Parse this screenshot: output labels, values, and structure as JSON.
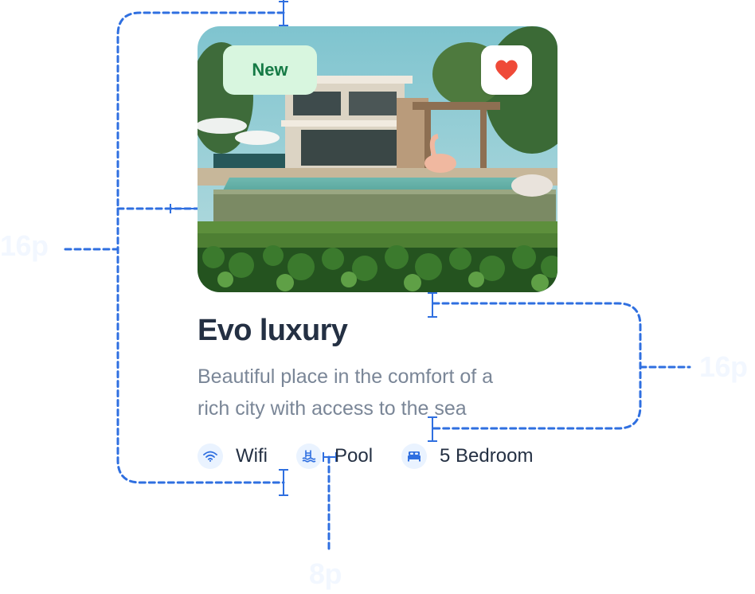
{
  "card": {
    "badge": "New",
    "title": "Evo luxury",
    "description_line1": "Beautiful place in the comfort of a",
    "description_line2": "rich city with access to the sea",
    "features": [
      {
        "label": "Wifi",
        "icon": "wifi-icon"
      },
      {
        "label": "Pool",
        "icon": "pool-icon"
      },
      {
        "label": "5 Bedroom",
        "icon": "bed-icon"
      }
    ]
  },
  "annotations": {
    "left_spacing": "16p",
    "right_spacing": "16p",
    "bottom_spacing": "8p"
  },
  "colors": {
    "badge_background": "#d8f6df",
    "badge_text": "#157a45",
    "heart": "#ef4a38",
    "guide_line": "#2f6fe0",
    "title": "#243043",
    "description": "#7a8697",
    "icon_tint": "#2f6fe0"
  }
}
